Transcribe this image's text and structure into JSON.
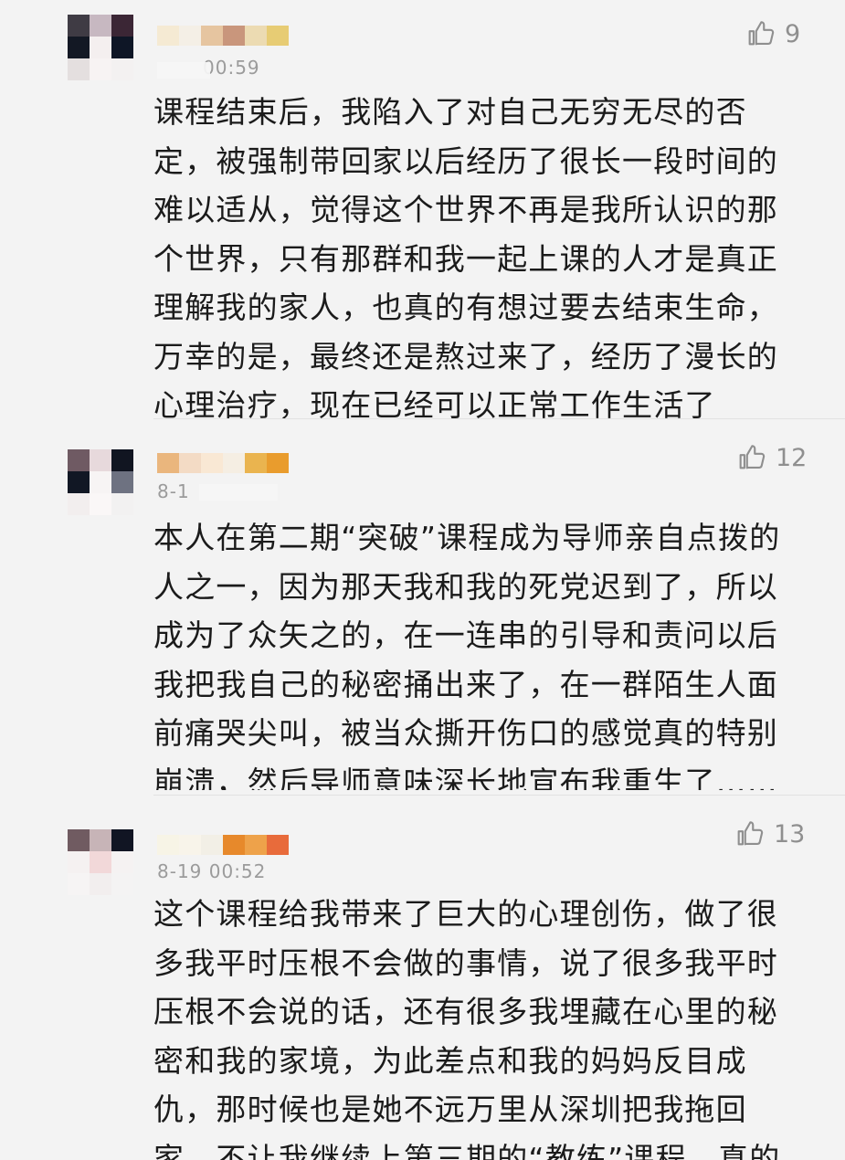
{
  "comments": [
    {
      "time": "00:59",
      "likes": "9",
      "text": "课程结束后，我陷入了对自己无穷无尽的否\n定，被强制带回家以后经历了很长一段时间的\n难以适从，觉得这个世界不再是我所认识的那\n个世界，只有那群和我一起上课的人才是真正\n理解我的家人，也真的有想过要去结束生命，\n万幸的是，最终还是熬过来了，经历了漫长的\n心理治疗，现在已经可以正常工作生活了"
    },
    {
      "time": "8-1",
      "likes": "12",
      "text": "本人在第二期“突破”课程成为导师亲自点拨的\n人之一，因为那天我和我的死党迟到了，所以\n成为了众矢之的，在一连串的引导和责问以后\n我把我自己的秘密捅出来了，在一群陌生人面\n前痛哭尖叫，被当众撕开伤口的感觉真的特别\n崩溃，然后导师意味深长地宣布我重生了……"
    },
    {
      "time": "8-19 00:52",
      "likes": "13",
      "text": "这个课程给我带来了巨大的心理创伤，做了很\n多我平时压根不会做的事情，说了很多我平时\n压根不会说的话，还有很多我埋藏在心里的秘\n密和我的家境，为此差点和我的妈妈反目成\n仇，那时候也是她不远万里从深圳把我拖回\n家，不让我继续上第三期的“教练”课程，真的"
    }
  ],
  "colors": {
    "background": "#f3f3f3",
    "text": "#1b1b1b",
    "meta": "#9b9b9b",
    "like": "#8f8f8f"
  },
  "icons": {
    "like": "thumbs-up-icon"
  }
}
